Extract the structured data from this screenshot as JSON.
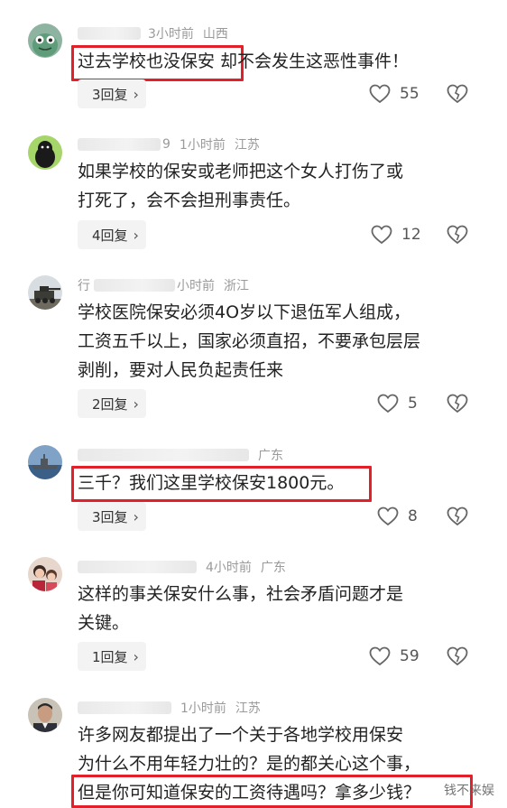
{
  "comments": [
    {
      "time": "3小时前",
      "location": "山西",
      "text": [
        "过去学校也没保安   却不会发生这恶性事件！"
      ],
      "reply_label": "3回复",
      "likes": "55",
      "avatar": "green-monster-avatar"
    },
    {
      "name_tail": "9",
      "time": "1小时前",
      "location": "江苏",
      "text": [
        "如果学校的保安或老师把这个女人打伤了或",
        "打死了，会不会担刑事责任。"
      ],
      "reply_label": "4回复",
      "likes": "12",
      "avatar": "black-blob-avatar"
    },
    {
      "name_head": "行",
      "time": "小时前",
      "location": "浙江",
      "text": [
        "学校医院保安必须4O岁以下退伍军人组成，",
        "工资五千以上，国家必须直招，不要承包层层",
        "剥削，要对人民负起责任来"
      ],
      "reply_label": "2回复",
      "likes": "5",
      "avatar": "tank-photo-avatar"
    },
    {
      "location": "广东",
      "text": [
        "三千？我们这里学校保安1800元。"
      ],
      "reply_label": "3回复",
      "likes": "8",
      "avatar": "warship-photo-avatar"
    },
    {
      "time": "4小时前",
      "location": "广东",
      "text": [
        "这样的事关保安什么事，社会矛盾问题才是",
        "关键。"
      ],
      "reply_label": "1回复",
      "likes": "59",
      "avatar": "family-photo-avatar"
    },
    {
      "time": "1小时前",
      "location": "江苏",
      "text": [
        "许多网友都提出了一个关于各地学校用保安",
        "为什么不用年轻力壮的？是的都关心这个事，",
        "但是你可知道保安的工资待遇吗？拿多少钱？"
      ],
      "avatar": "man-portrait-avatar"
    }
  ],
  "watermark": "钱不来娱",
  "colors": {
    "highlight": "#e3202a",
    "meta_gray": "#9a9a9a",
    "button_bg": "#f3f3f3"
  }
}
